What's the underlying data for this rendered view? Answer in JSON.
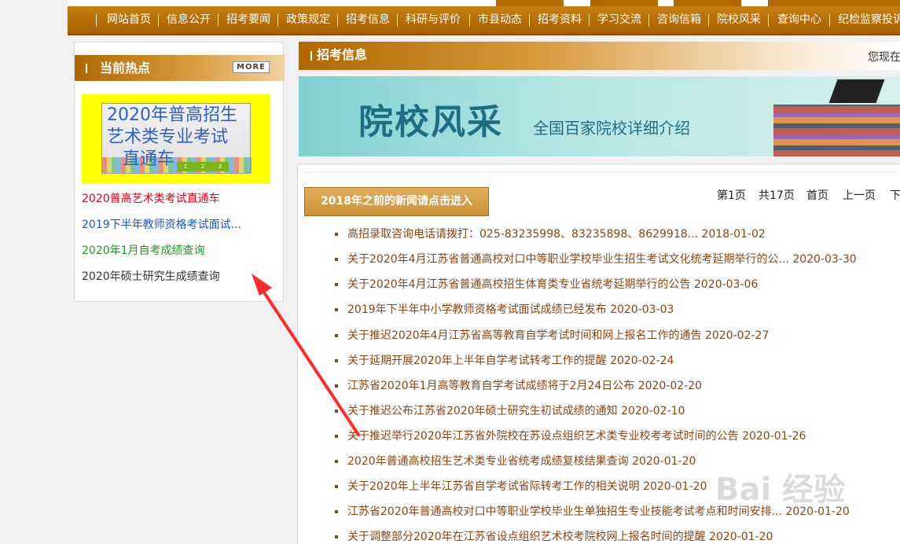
{
  "nav": {
    "items": [
      "网站首页",
      "信息公开",
      "招考要闻",
      "政策规定",
      "招考信息",
      "科研与评价",
      "市县动态",
      "招考资料",
      "学习交流",
      "咨询信箱",
      "院校风采",
      "查询中心",
      "纪检监察投诉"
    ]
  },
  "sidebar": {
    "title": "当前热点",
    "more_label": "MORE",
    "banner": {
      "line1": "2020年普高招生",
      "line2": "艺术类专业考试",
      "line3": "直通车",
      "pages": [
        "1",
        "2",
        "3"
      ]
    },
    "links": [
      {
        "text": "2020普高艺术类考试直通车",
        "color": "#e60012"
      },
      {
        "text": "2019下半年教师资格考试面试...",
        "color": "#1a56c4"
      },
      {
        "text": "2020年1月自考成绩查询",
        "color": "#1e9a1e"
      },
      {
        "text": "2020年硕士研究生成绩查询",
        "color": "#333333"
      }
    ]
  },
  "main": {
    "section_title": "招考信息",
    "location_label": "您现在",
    "ad": {
      "title": "院校风采",
      "subtitle": "全国百家院校详细介绍"
    },
    "old_news_button": "2018年之前的新闻请点击进入",
    "pager": {
      "current": "第1页",
      "total": "共17页",
      "first": "首页",
      "prev": "上一页",
      "next": "下"
    },
    "news": [
      "高招录取咨询电话请拨打：025-83235998、83235898、8629918... 2018-01-02",
      "关于2020年4月江苏省普通高校对口中等职业学校毕业生招生考试文化统考延期举行的公... 2020-03-30",
      "关于2020年4月江苏省普通高校招生体育类专业省统考延期举行的公告 2020-03-06",
      "2019年下半年中小学教师资格考试面试成绩已经发布 2020-03-03",
      "关于推迟2020年4月江苏省高等教育自学考试时间和网上报名工作的通告 2020-02-27",
      "关于延期开展2020年上半年自学考试转考工作的提醒 2020-02-24",
      "江苏省2020年1月高等教育自学考试成绩将于2月24日公布 2020-02-20",
      "关于推迟公布江苏省2020年硕士研究生初试成绩的通知 2020-02-10",
      "关于推迟举行2020年江苏省外院校在苏设点组织艺术类专业校考考试时间的公告 2020-01-26",
      "2020年普通高校招生艺术类专业省统考成绩复核结果查询 2020-01-20",
      "关于2020年上半年江苏省自学考试省际转考工作的相关说明 2020-01-20",
      "江苏省2020年普通高校对口中等职业学校毕业生单独招生专业技能考试考点和时间安排... 2020-01-20",
      "关于调整部分2020年在江苏省设点组织艺术校考院校网上报名时间的提醒 2020-01-20"
    ]
  },
  "watermark": "Bai 经验",
  "colors": {
    "nav_bar": "#b26a00",
    "arrow": "#ff2a2a",
    "news_link": "#8b4513"
  }
}
